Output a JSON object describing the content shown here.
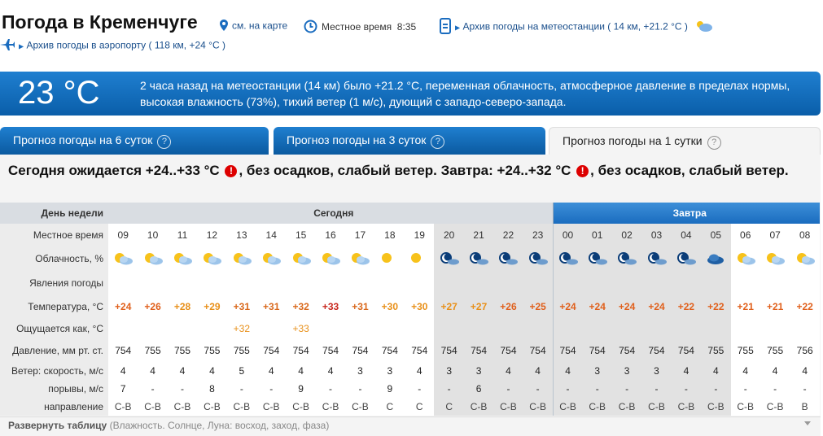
{
  "header": {
    "title": "Погода в Кременчуге",
    "map_link": "см. на карте",
    "local_time_label": "Местное время",
    "local_time": "8:35",
    "archive_station": "Архив погоды на метеостанции ( 14 км, +21.2 °C )",
    "archive_airport": "Архив погоды в аэропорту ( 118 км, +24 °C )"
  },
  "current": {
    "temp": "23 °C",
    "description": "2 часа назад на метеостанции (14 км) было +21.2 °C, переменная облачность, атмосферное давление в пределах нормы, высокая влажность (73%), тихий ветер (1 м/с), дующий с западо-северо-запада."
  },
  "tabs": [
    {
      "label": "Прогноз погоды на 6 суток",
      "active": false
    },
    {
      "label": "Прогноз погоды на 3 суток",
      "active": false
    },
    {
      "label": "Прогноз погоды на 1 сутки",
      "active": true
    }
  ],
  "summary": {
    "part1": "Сегодня ожидается +24..+33 °C",
    "part2": ", без осадков, слабый ветер. Завтра: +24..+32 °C",
    "part3": ", без осадков, слабый ветер.",
    "warn_symbol": "!"
  },
  "table": {
    "labels": {
      "day": "День недели",
      "time": "Местное время",
      "cloud": "Облачность, %",
      "phenom": "Явления погоды",
      "temp": "Температура, °C",
      "feels": "Ощущается как, °C",
      "pressure": "Давление, мм рт. ст.",
      "wind_speed": "Ветер: скорость, м/с",
      "gusts": "порывы, м/с",
      "direction": "направление"
    },
    "day_today": "Сегодня",
    "day_tomorrow": "Завтра",
    "hours": [
      "09",
      "10",
      "11",
      "12",
      "13",
      "14",
      "15",
      "16",
      "17",
      "18",
      "19",
      "20",
      "21",
      "22",
      "23",
      "00",
      "01",
      "02",
      "03",
      "04",
      "05",
      "06",
      "07",
      "08"
    ],
    "night": [
      false,
      false,
      false,
      false,
      false,
      false,
      false,
      false,
      false,
      false,
      false,
      true,
      true,
      true,
      true,
      true,
      true,
      true,
      true,
      true,
      true,
      false,
      false,
      false
    ],
    "cloud_icons": [
      "sun-cloud",
      "sun-cloud",
      "sun-cloud",
      "sun-cloud",
      "sun-cloud",
      "sun-cloud",
      "sun-cloud",
      "sun-cloud",
      "sun-cloud",
      "sun",
      "sun",
      "moon-cloud",
      "moon-cloud",
      "moon-cloud",
      "moon-cloud",
      "moon-cloud",
      "moon-cloud",
      "moon-cloud",
      "moon-cloud",
      "moon-cloud",
      "cloud",
      "sun-cloud",
      "sun-cloud",
      "sun-cloud"
    ],
    "temps": [
      "+24",
      "+26",
      "+28",
      "+29",
      "+31",
      "+31",
      "+32",
      "+33",
      "+31",
      "+30",
      "+30",
      "+27",
      "+27",
      "+26",
      "+25",
      "+24",
      "+24",
      "+24",
      "+24",
      "+22",
      "+22",
      "+21",
      "+21",
      "+22"
    ],
    "feels": [
      "",
      "",
      "",
      "",
      "+32",
      "",
      "+33",
      "",
      "",
      "",
      "",
      "",
      "",
      "",
      "",
      "",
      "",
      "",
      "",
      "",
      "",
      "",
      "",
      ""
    ],
    "pressure": [
      "754",
      "755",
      "755",
      "755",
      "755",
      "754",
      "754",
      "754",
      "754",
      "754",
      "754",
      "754",
      "754",
      "754",
      "754",
      "754",
      "754",
      "754",
      "754",
      "754",
      "755",
      "755",
      "755",
      "756"
    ],
    "wind": [
      "4",
      "4",
      "4",
      "4",
      "5",
      "4",
      "4",
      "4",
      "3",
      "3",
      "4",
      "3",
      "3",
      "4",
      "4",
      "4",
      "3",
      "3",
      "3",
      "4",
      "4",
      "4",
      "4",
      "4"
    ],
    "gusts": [
      "7",
      "-",
      "-",
      "8",
      "-",
      "-",
      "9",
      "-",
      "-",
      "9",
      "-",
      "-",
      "6",
      "-",
      "-",
      "-",
      "-",
      "-",
      "-",
      "-",
      "-",
      "-",
      "-",
      "-"
    ],
    "direction": [
      "С-В",
      "С-В",
      "С-В",
      "С-В",
      "С-В",
      "С-В",
      "С-В",
      "С-В",
      "С-В",
      "С",
      "С",
      "С",
      "С-В",
      "С-В",
      "С-В",
      "С-В",
      "С-В",
      "С-В",
      "С-В",
      "С-В",
      "С-В",
      "С-В",
      "С-В",
      "В"
    ]
  },
  "expand": {
    "label": "Развернуть таблицу",
    "hint": "(Влажность. Солнце, Луна: восход, заход, фаза)"
  },
  "colors": {
    "accent": "#1a6cbf",
    "link": "#1a4f8c",
    "warning": "#dd0000"
  }
}
